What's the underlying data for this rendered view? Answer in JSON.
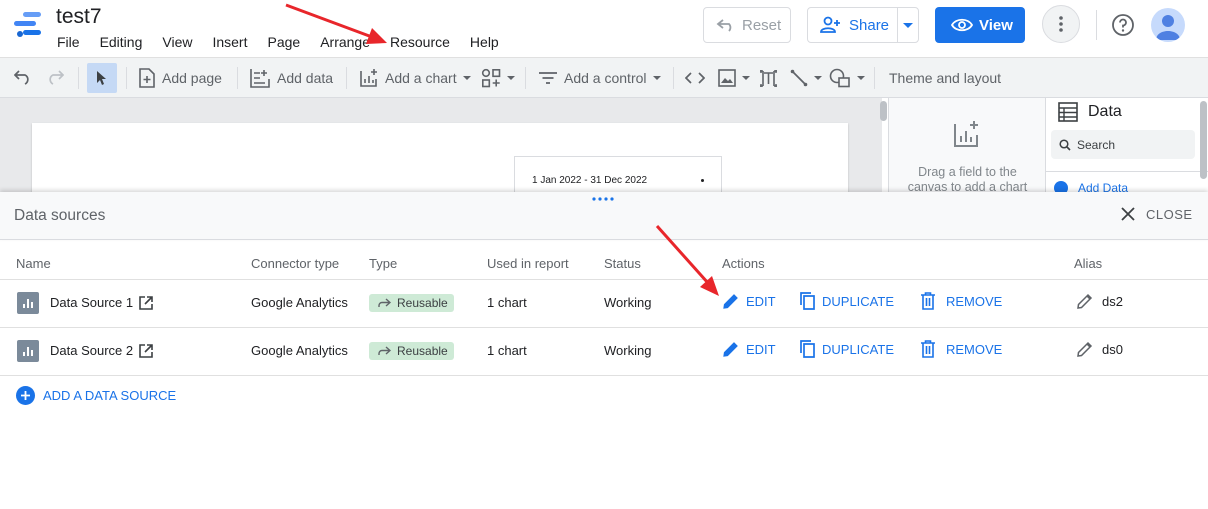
{
  "header": {
    "doc_title": "test7",
    "menu": [
      "File",
      "Editing",
      "View",
      "Insert",
      "Page",
      "Arrange",
      "Resource",
      "Help"
    ],
    "reset_label": "Reset",
    "share_label": "Share",
    "view_label": "View"
  },
  "toolbar": {
    "add_page": "Add page",
    "add_data": "Add data",
    "add_chart": "Add a chart",
    "add_control": "Add a control",
    "theme_layout": "Theme and layout"
  },
  "canvas": {
    "date_range": "1 Jan 2022 - 31 Dec 2022"
  },
  "properties": {
    "hint_line1": "Drag a field to the",
    "hint_line2": "canvas to add a chart"
  },
  "data_panel": {
    "title": "Data",
    "search_placeholder": "Search",
    "add_data": "Add Data"
  },
  "data_sources": {
    "title": "Data sources",
    "close_label": "CLOSE",
    "columns": [
      "Name",
      "Connector type",
      "Type",
      "Used in report",
      "Status",
      "Actions",
      "Alias"
    ],
    "rows": [
      {
        "name": "Data Source 1",
        "connector": "Google Analytics",
        "type": "Reusable",
        "used": "1 chart",
        "status": "Working",
        "alias": "ds2"
      },
      {
        "name": "Data Source 2",
        "connector": "Google Analytics",
        "type": "Reusable",
        "used": "1 chart",
        "status": "Working",
        "alias": "ds0"
      }
    ],
    "actions": {
      "edit": "EDIT",
      "duplicate": "DUPLICATE",
      "remove": "REMOVE"
    },
    "add_label": "ADD A DATA SOURCE"
  },
  "colors": {
    "accent": "#1a73e8",
    "annotation_arrow": "#e8262b",
    "reusable_badge": "#ceead6"
  }
}
